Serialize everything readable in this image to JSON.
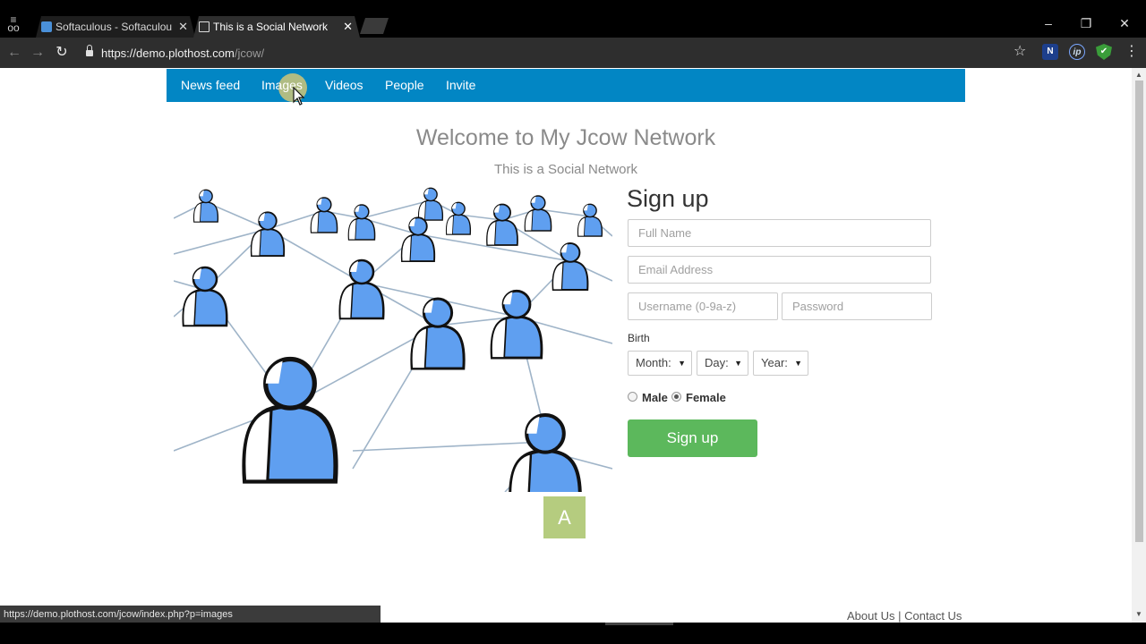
{
  "browser": {
    "tabs": [
      {
        "title": "Softaculous - Softaculou",
        "active": false
      },
      {
        "title": "This is a Social Network",
        "active": true
      }
    ],
    "close_glyph": "✕",
    "url_host": "https://demo.plothost.com",
    "url_path": "/jcow/",
    "extensions": [
      {
        "name": "n-extension-icon",
        "label": "N"
      },
      {
        "name": "ip-extension-icon",
        "label": "ip"
      },
      {
        "name": "shield-extension-icon",
        "label": "✔"
      }
    ]
  },
  "nav": {
    "items": [
      "News feed",
      "Images",
      "Videos",
      "People",
      "Invite"
    ]
  },
  "hero": {
    "title": "Welcome to My Jcow Network",
    "subtitle": "This is a Social Network"
  },
  "signup": {
    "title": "Sign up",
    "fullname_placeholder": "Full Name",
    "email_placeholder": "Email Address",
    "username_placeholder": "Username (0-9a-z)",
    "password_placeholder": "Password",
    "birth_label": "Birth",
    "month_label": "Month:",
    "day_label": "Day:",
    "year_label": "Year:",
    "male_label": "Male",
    "female_label": "Female",
    "selected_gender": "female",
    "button_label": "Sign up"
  },
  "avatar_letter": "A",
  "status_bar_url": "https://demo.plothost.com/jcow/index.php?p=images",
  "footer": {
    "about": "About Us",
    "separator": "|",
    "contact": "Contact Us"
  },
  "colors": {
    "nav_bg": "#0286c4",
    "signup_button": "#5cb85c",
    "avatar_bg": "#b5cc7f",
    "person_fill": "#5f9ff0"
  }
}
